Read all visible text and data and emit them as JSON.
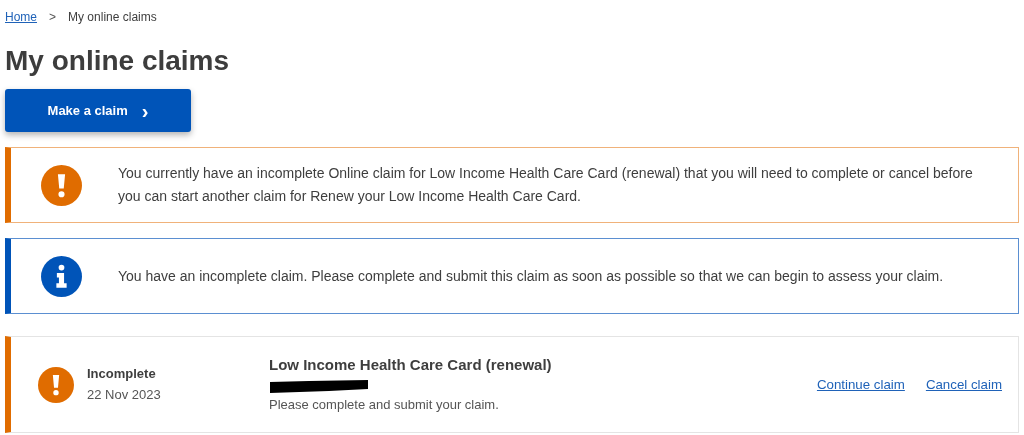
{
  "breadcrumb": [
    {
      "label": "Home",
      "kind": "link"
    },
    {
      "label": "My online claims",
      "kind": "current"
    }
  ],
  "breadcrumb_separator": ">",
  "title": "My online claims",
  "primary_button": {
    "label": "Make a claim",
    "chevron": "›"
  },
  "alerts": [
    {
      "kind": "warning",
      "text": "You currently have an incomplete Online claim for Low Income Health Care Card (renewal) that you will need to complete or cancel before you can start another claim for Renew your Low Income Health Care Card."
    },
    {
      "kind": "info",
      "text": "You have an incomplete claim. Please complete and submit this claim as soon as possible so that we can begin to assess your claim."
    }
  ],
  "claims": [
    {
      "kind": "warning",
      "status": "Incomplete",
      "date": "22 Nov 2023",
      "name": "Low Income Health Care Card (renewal)",
      "redacted": true,
      "note": "Please complete and submit your claim.",
      "actions": [
        "Continue claim",
        "Cancel claim"
      ]
    }
  ]
}
